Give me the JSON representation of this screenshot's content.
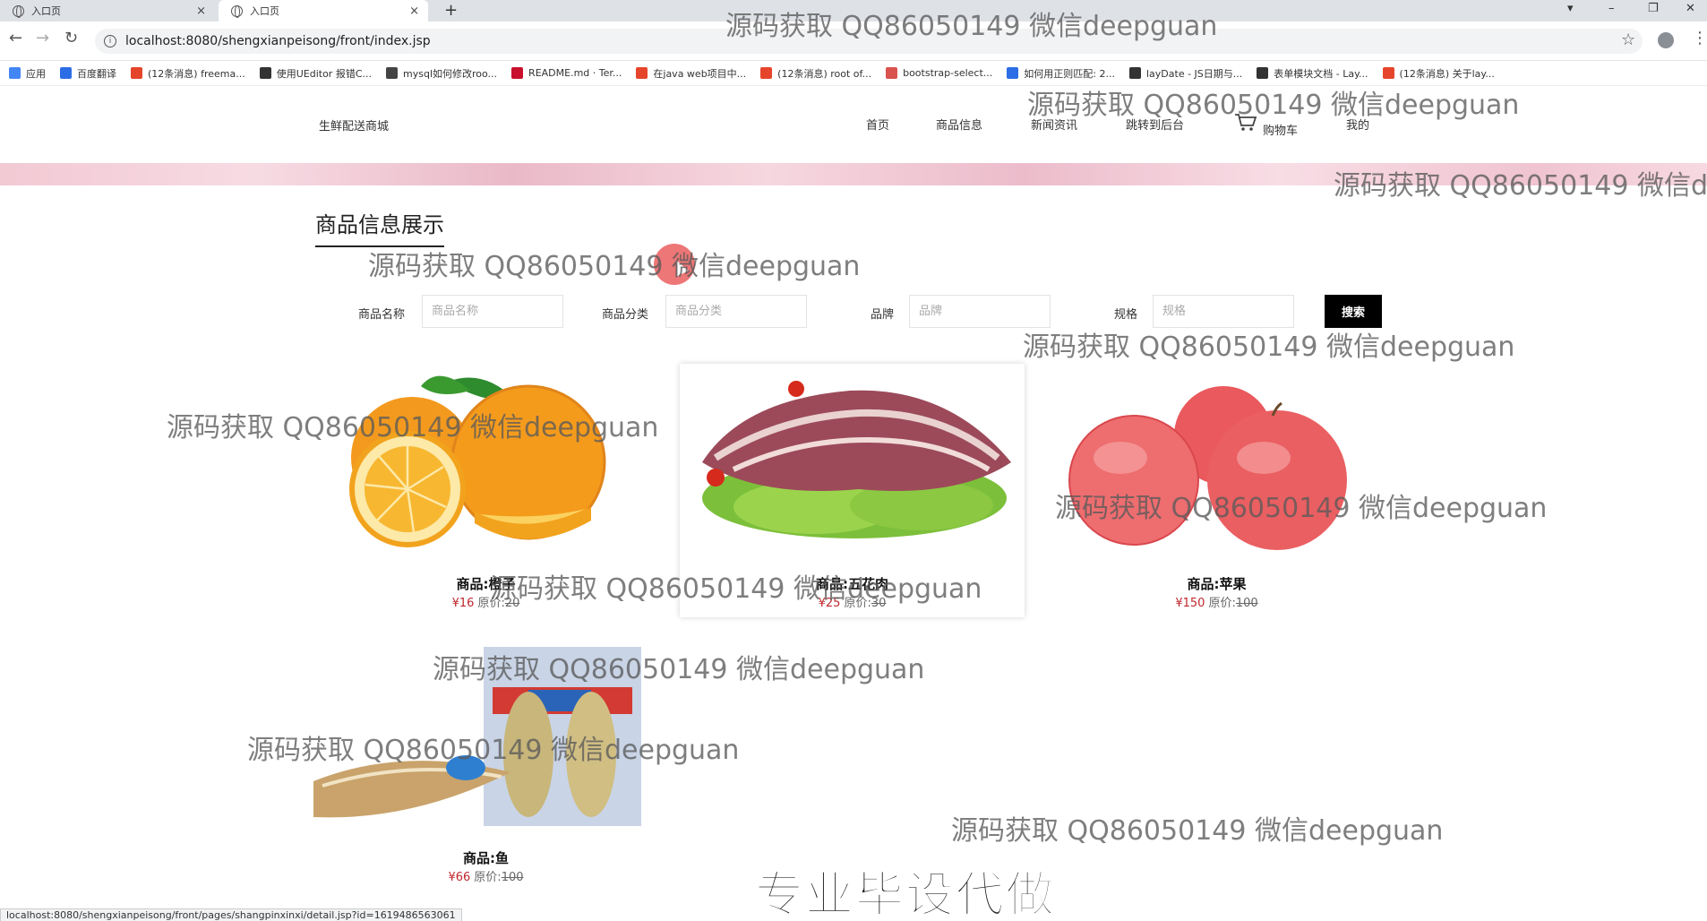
{
  "browser": {
    "tabs": [
      {
        "label": "入口页"
      },
      {
        "label": "入口页"
      }
    ],
    "url": "localhost:8080/shengxianpeisong/front/index.jsp",
    "bookmarks": [
      {
        "label": "应用",
        "color": "#4285f4"
      },
      {
        "label": "百度翻译",
        "color": "#2b6de5"
      },
      {
        "label": "(12条消息) freema...",
        "color": "#e5452b"
      },
      {
        "label": "使用UEditor 报错C...",
        "color": "#333333"
      },
      {
        "label": "mysql如何修改roo...",
        "color": "#444444"
      },
      {
        "label": "README.md · Ter...",
        "color": "#c8102e"
      },
      {
        "label": "在java web项目中...",
        "color": "#e5452b"
      },
      {
        "label": "(12条消息) root of...",
        "color": "#e5452b"
      },
      {
        "label": "bootstrap-select...",
        "color": "#d9534f"
      },
      {
        "label": "如何用正则匹配: 2...",
        "color": "#2b6de5"
      },
      {
        "label": "layDate - JS日期与...",
        "color": "#333333"
      },
      {
        "label": "表单模块文档 - Lay...",
        "color": "#333333"
      },
      {
        "label": "(12条消息) 关于lay...",
        "color": "#e5452b"
      }
    ],
    "status_url": "localhost:8080/shengxianpeisong/front/pages/shangpinxinxi/detail.jsp?id=1619486563061"
  },
  "site": {
    "brand": "生鲜配送商城",
    "nav": [
      {
        "label": "首页"
      },
      {
        "label": "商品信息"
      },
      {
        "label": "新闻资讯"
      },
      {
        "label": "跳转到后台"
      },
      {
        "label": "购物车"
      },
      {
        "label": "我的"
      }
    ]
  },
  "main": {
    "section_title": "商品信息展示",
    "search": {
      "fields": [
        {
          "label": "商品名称",
          "placeholder": "商品名称"
        },
        {
          "label": "商品分类",
          "placeholder": "商品分类"
        },
        {
          "label": "品牌",
          "placeholder": "品牌"
        },
        {
          "label": "规格",
          "placeholder": "规格"
        }
      ],
      "button": "搜索"
    },
    "products": [
      {
        "name": "商品:橙子",
        "price": "¥16",
        "orig_label": "原价:",
        "orig_price": "20"
      },
      {
        "name": "商品:五花肉",
        "price": "¥25",
        "orig_label": "原价:",
        "orig_price": "30"
      },
      {
        "name": "商品:苹果",
        "price": "¥150",
        "orig_label": "原价:",
        "orig_price": "100"
      },
      {
        "name": "商品:鱼",
        "price": "¥66",
        "orig_label": "原价:",
        "orig_price": "100"
      }
    ]
  },
  "overlay": {
    "watermark": "源码获取 QQ86050149 微信deepguan",
    "watermark_cut": "源码获取 QQ86050149 微信de",
    "caption": "专业毕设代做"
  }
}
